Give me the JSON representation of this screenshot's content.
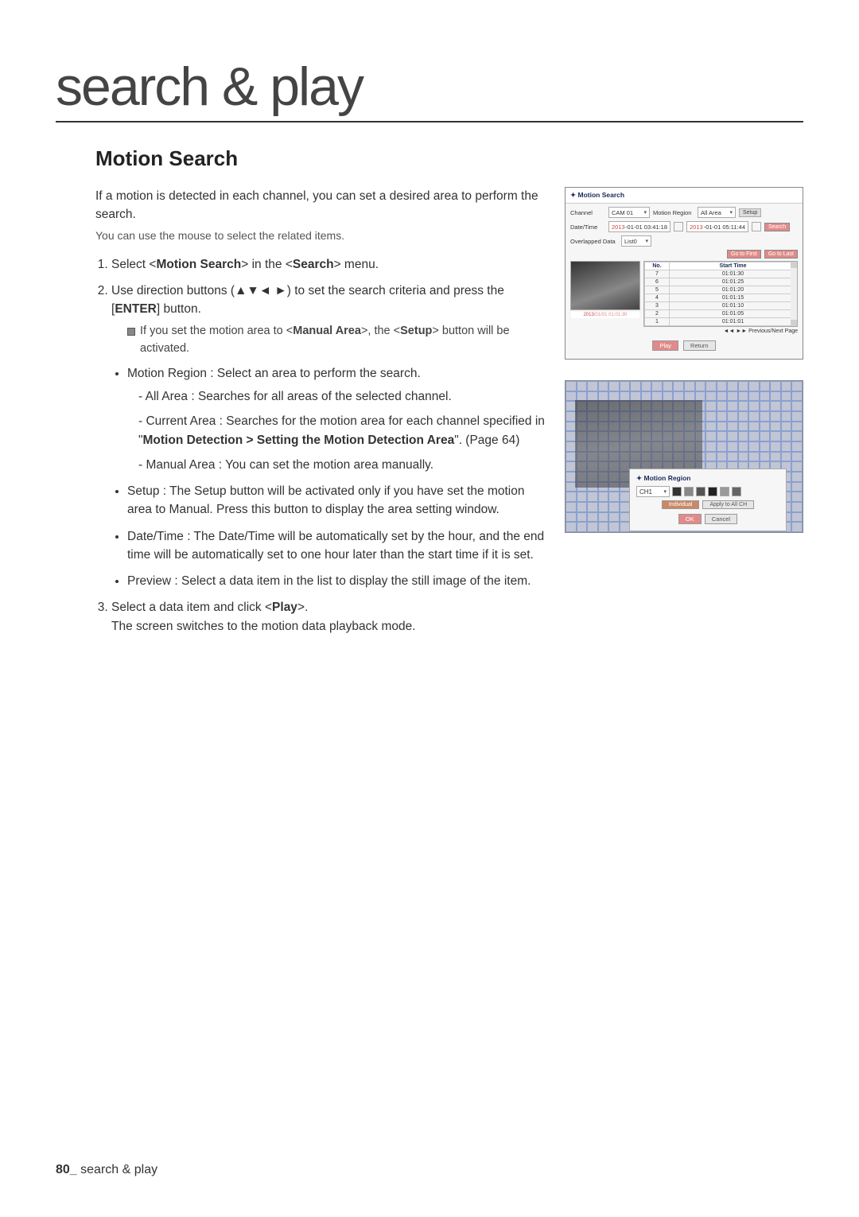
{
  "chapter": "search & play",
  "section": "Motion Search",
  "intro": "If a motion is detected in each channel, you can set a desired area to perform the search.",
  "intro_sub": "You can use the mouse to select the related items.",
  "step1": "Select <Motion Search> in the <Search> menu.",
  "step2": "Use direction buttons (▲▼◄ ►) to set the search criteria and press the [ENTER] button.",
  "step2_note": "If you set the motion area to <Manual Area>, the <Setup> button will be activated.",
  "b_region_head": "Motion Region : Select an area to perform the search.",
  "b_region_all": "All Area : Searches for all areas of the selected channel.",
  "b_region_current": "Current Area : Searches for the motion area for each channel specified in \"Motion Detection > Setting the Motion Detection Area\". (Page 64)",
  "b_region_current_plain_pre": "Current Area : Searches for the motion area for each channel specified in \"",
  "b_region_current_bold": "Motion Detection > Setting the Motion Detection Area",
  "b_region_current_plain_post": "\". (Page 64)",
  "b_region_manual": "Manual Area : You can set the motion area manually.",
  "b_setup": "Setup : The Setup button will be activated only if you have set the motion area to Manual. Press this button to display the area setting window.",
  "b_datetime": "Date/Time : The Date/Time will be automatically set by the hour, and the end time will be automatically set to one hour later than the start time if it is set.",
  "b_preview": "Preview : Select a data item in the list to display the still image of the item.",
  "step3_a": "Select a data item and click <Play>.",
  "step3_b": "The screen switches to the motion data playback mode.",
  "fig1": {
    "title": "Motion Search",
    "channel_lbl": "Channel",
    "channel_val": "CAM 01",
    "region_lbl": "Motion Region",
    "region_val": "All Area",
    "setup_btn": "Setup",
    "datetime_lbl": "Date/Time",
    "dt_start": "2013-01-01 03:41:18",
    "dt_end": "2013-01-01 05:11:44",
    "search_btn": "Search",
    "overlap_lbl": "Overlapped Data",
    "overlap_val": "List0",
    "goto_first": "Go to First",
    "goto_last": "Go to Last",
    "col_no": "No.",
    "col_start": "Start Time",
    "preview_ts": "2013/01/01 01:01:30",
    "rows": [
      {
        "no": "7",
        "t": "01:01:30"
      },
      {
        "no": "6",
        "t": "01:01:25"
      },
      {
        "no": "5",
        "t": "01:01:20"
      },
      {
        "no": "4",
        "t": "01:01:15"
      },
      {
        "no": "3",
        "t": "01:01:10"
      },
      {
        "no": "2",
        "t": "01:01:05"
      },
      {
        "no": "1",
        "t": "01:01:01"
      }
    ],
    "prevnext": "◄◄ ►► Previous/Next Page",
    "play": "Play",
    "return": "Return"
  },
  "fig2": {
    "title": "Motion Region",
    "ch_val": "CH1",
    "indiv": "Individual",
    "apply_all": "Apply to All CH",
    "ok": "OK",
    "cancel": "Cancel"
  },
  "footer_page": "80_",
  "footer_text": " search & play"
}
